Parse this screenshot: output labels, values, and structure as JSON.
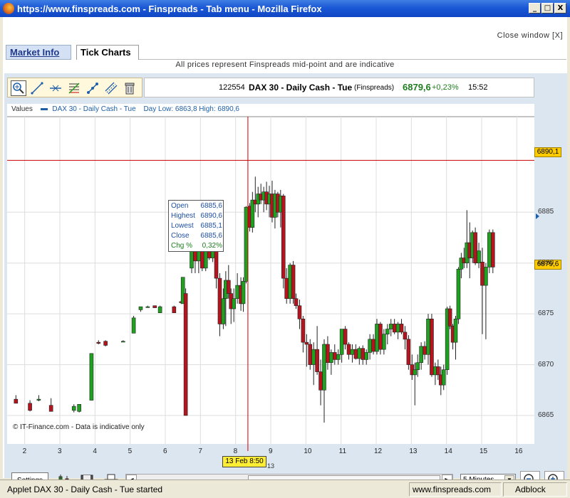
{
  "window": {
    "title": "https://www.finspreads.com - Finspreads - Tab menu - Mozilla Firefox",
    "min_label": "_",
    "max_label": "□",
    "close_label": "X"
  },
  "page": {
    "close_window": "Close window [X]",
    "tabs": [
      {
        "label": "Market Info"
      },
      {
        "label": "Tick Charts"
      }
    ],
    "notice": "All prices represent Finspreads mid-point and are indicative"
  },
  "toolbar": {
    "tools": [
      "zoom-select-icon",
      "trend-line-icon",
      "horizontal-line-icon",
      "fibonacci-icon",
      "line-tool-icon",
      "parallel-lines-icon",
      "trash-icon"
    ]
  },
  "info": {
    "id": "122554",
    "instrument": "DAX 30 - Daily Cash - Tue",
    "source": "(Finspreads)",
    "price": "6879,6",
    "change": "+0,23%",
    "time": "15:52"
  },
  "legend": {
    "values_label": "Values",
    "series": "DAX 30 - Daily Cash - Tue",
    "daylow": "Day Low: 6863,8 High: 6890,6"
  },
  "tooltip": {
    "rows": [
      {
        "k": "Open",
        "v": "6885,6"
      },
      {
        "k": "Highest",
        "v": "6890,6"
      },
      {
        "k": "Lowest",
        "v": "6885,1"
      },
      {
        "k": "Close",
        "v": "6885,6"
      },
      {
        "k": "Chg %",
        "v": "0,32%"
      }
    ]
  },
  "price_tags": {
    "high": "6890,1",
    "last": "6879,6"
  },
  "crosshair": {
    "time": "13 Feb 8:50",
    "sub": "13"
  },
  "copyright": "© IT-Finance.com - Data is indicative only",
  "controls": {
    "settings": "Settings",
    "interval": "5 Minutes",
    "dropdown_arrow": "▼",
    "scroll_left": "◀",
    "scroll_right": "▶"
  },
  "status": {
    "text": "Applet DAX 30 - Daily Cash - Tue started",
    "domain": "www.finspreads.com",
    "adblock": "Adblock"
  },
  "colors": {
    "up": "#1ea11e",
    "down": "#b3141e",
    "crosshair": "#c80000",
    "grid": "#dddddd"
  },
  "chart_data": {
    "type": "candlestick",
    "title": "DAX 30 - Daily Cash - Tue",
    "x_ticks": [
      "2",
      "3",
      "4",
      "5",
      "6",
      "7",
      "8",
      "9",
      "10",
      "11",
      "12",
      "13",
      "14",
      "15",
      "16"
    ],
    "x_tick_values": [
      2,
      3,
      4,
      5,
      6,
      7,
      8,
      9,
      10,
      11,
      12,
      13,
      14,
      15,
      16
    ],
    "xlim": [
      1.5,
      16.5
    ],
    "y_ticks": [
      "6865",
      "6870",
      "6875",
      "6880",
      "6885"
    ],
    "y_tick_values": [
      6865,
      6870,
      6875,
      6880,
      6885
    ],
    "ylim": [
      6862.2,
      6894.4
    ],
    "high_line": 6890.1,
    "crosshair_x": 8.35,
    "grid": true,
    "candles": [
      {
        "t": 1.75,
        "o": 6866.6,
        "h": 6867.0,
        "l": 6866.3,
        "c": 6866.2
      },
      {
        "t": 2.15,
        "o": 6866.2,
        "h": 6866.5,
        "l": 6865.4,
        "c": 6865.5
      },
      {
        "t": 2.4,
        "o": 6866.5,
        "h": 6867.0,
        "l": 6866.4,
        "c": 6866.6
      },
      {
        "t": 2.75,
        "o": 6866.0,
        "h": 6866.7,
        "l": 6865.4,
        "c": 6865.4
      },
      {
        "t": 3.4,
        "o": 6865.5,
        "h": 6866.1,
        "l": 6865.3,
        "c": 6865.9
      },
      {
        "t": 3.55,
        "o": 6865.4,
        "h": 6866.0,
        "l": 6865.3,
        "c": 6866.1
      },
      {
        "t": 3.9,
        "o": 6866.5,
        "h": 6871.1,
        "l": 6866.5,
        "c": 6871.1
      },
      {
        "t": 4.1,
        "o": 6872.2,
        "h": 6872.4,
        "l": 6872.0,
        "c": 6872.1
      },
      {
        "t": 4.3,
        "o": 6872.3,
        "h": 6872.4,
        "l": 6871.8,
        "c": 6871.9
      },
      {
        "t": 4.8,
        "o": 6872.3,
        "h": 6872.4,
        "l": 6872.3,
        "c": 6872.3
      },
      {
        "t": 5.1,
        "o": 6873.1,
        "h": 6874.8,
        "l": 6873.1,
        "c": 6874.6
      },
      {
        "t": 5.3,
        "o": 6875.4,
        "h": 6875.7,
        "l": 6875.2,
        "c": 6875.7
      },
      {
        "t": 5.5,
        "o": 6875.7,
        "h": 6875.8,
        "l": 6875.6,
        "c": 6875.7
      },
      {
        "t": 5.7,
        "o": 6875.8,
        "h": 6875.8,
        "l": 6875.6,
        "c": 6875.6
      },
      {
        "t": 5.85,
        "o": 6875.1,
        "h": 6875.8,
        "l": 6875.1,
        "c": 6875.7
      },
      {
        "t": 6.25,
        "o": 6875.7,
        "h": 6875.8,
        "l": 6875.1,
        "c": 6875.1
      },
      {
        "t": 6.45,
        "o": 6876.2,
        "h": 6876.3,
        "l": 6876.0,
        "c": 6876.1
      },
      {
        "t": 6.5,
        "o": 6876.0,
        "h": 6878.6,
        "l": 6876.0,
        "c": 6878.6
      },
      {
        "t": 6.58,
        "o": 6877.0,
        "h": 6877.5,
        "l": 6865.0,
        "c": 6865.0
      },
      {
        "t": 6.75,
        "o": 6879.5,
        "h": 6882.0,
        "l": 6879.0,
        "c": 6881.5
      },
      {
        "t": 6.85,
        "o": 6881.5,
        "h": 6882.0,
        "l": 6879.0,
        "c": 6880.2
      },
      {
        "t": 6.95,
        "o": 6880.2,
        "h": 6884.2,
        "l": 6879.0,
        "c": 6884.0
      },
      {
        "t": 7.05,
        "o": 6884.0,
        "h": 6884.3,
        "l": 6879.2,
        "c": 6879.5
      },
      {
        "t": 7.15,
        "o": 6879.5,
        "h": 6881.7,
        "l": 6879.2,
        "c": 6881.4
      },
      {
        "t": 7.25,
        "o": 6881.4,
        "h": 6883.0,
        "l": 6880.3,
        "c": 6880.5
      },
      {
        "t": 7.35,
        "o": 6880.5,
        "h": 6884.5,
        "l": 6880.1,
        "c": 6882.1
      },
      {
        "t": 7.45,
        "o": 6882.1,
        "h": 6883.5,
        "l": 6877.5,
        "c": 6878.5
      },
      {
        "t": 7.55,
        "o": 6878.5,
        "h": 6879.0,
        "l": 6872.8,
        "c": 6874.0
      },
      {
        "t": 7.65,
        "o": 6874.0,
        "h": 6877.5,
        "l": 6873.5,
        "c": 6876.5
      },
      {
        "t": 7.72,
        "o": 6876.5,
        "h": 6879.2,
        "l": 6873.8,
        "c": 6878.3
      },
      {
        "t": 7.8,
        "o": 6878.3,
        "h": 6879.8,
        "l": 6876.5,
        "c": 6877.0
      },
      {
        "t": 7.87,
        "o": 6877.0,
        "h": 6877.5,
        "l": 6874.0,
        "c": 6875.5
      },
      {
        "t": 7.95,
        "o": 6875.5,
        "h": 6877.5,
        "l": 6874.2,
        "c": 6876.5
      },
      {
        "t": 8.05,
        "o": 6876.5,
        "h": 6879.0,
        "l": 6876.0,
        "c": 6877.8
      },
      {
        "t": 8.15,
        "o": 6877.8,
        "h": 6878.6,
        "l": 6875.3,
        "c": 6876.0
      },
      {
        "t": 8.22,
        "o": 6876.0,
        "h": 6878.6,
        "l": 6875.2,
        "c": 6878.2
      },
      {
        "t": 8.3,
        "o": 6878.2,
        "h": 6885.6,
        "l": 6878.0,
        "c": 6885.5
      },
      {
        "t": 8.4,
        "o": 6885.6,
        "h": 6885.9,
        "l": 6883.1,
        "c": 6883.5
      },
      {
        "t": 8.48,
        "o": 6883.5,
        "h": 6887.0,
        "l": 6883.0,
        "c": 6886.2
      },
      {
        "t": 8.56,
        "o": 6886.2,
        "h": 6888.5,
        "l": 6885.0,
        "c": 6885.8
      },
      {
        "t": 8.64,
        "o": 6885.8,
        "h": 6887.5,
        "l": 6884.5,
        "c": 6886.8
      },
      {
        "t": 8.72,
        "o": 6886.8,
        "h": 6887.8,
        "l": 6885.8,
        "c": 6886.2
      },
      {
        "t": 8.8,
        "o": 6886.2,
        "h": 6887.5,
        "l": 6885.0,
        "c": 6887.0
      },
      {
        "t": 8.88,
        "o": 6887.0,
        "h": 6888.0,
        "l": 6885.2,
        "c": 6885.8
      },
      {
        "t": 8.96,
        "o": 6885.8,
        "h": 6887.6,
        "l": 6884.5,
        "c": 6886.8
      },
      {
        "t": 9.04,
        "o": 6886.8,
        "h": 6888.1,
        "l": 6884.0,
        "c": 6884.5
      },
      {
        "t": 9.12,
        "o": 6884.5,
        "h": 6887.2,
        "l": 6883.4,
        "c": 6886.8
      },
      {
        "t": 9.2,
        "o": 6886.8,
        "h": 6887.0,
        "l": 6884.5,
        "c": 6885.0
      },
      {
        "t": 9.28,
        "o": 6885.0,
        "h": 6887.2,
        "l": 6883.5,
        "c": 6886.6
      },
      {
        "t": 9.36,
        "o": 6886.6,
        "h": 6886.8,
        "l": 6877.5,
        "c": 6878.5
      },
      {
        "t": 9.45,
        "o": 6878.5,
        "h": 6879.5,
        "l": 6876.0,
        "c": 6876.5
      },
      {
        "t": 9.55,
        "o": 6876.5,
        "h": 6880.0,
        "l": 6876.0,
        "c": 6879.8
      },
      {
        "t": 9.64,
        "o": 6879.8,
        "h": 6880.2,
        "l": 6876.0,
        "c": 6876.5
      },
      {
        "t": 9.72,
        "o": 6876.5,
        "h": 6877.0,
        "l": 6875.5,
        "c": 6875.8
      },
      {
        "t": 9.82,
        "o": 6875.8,
        "h": 6876.4,
        "l": 6873.5,
        "c": 6874.5
      },
      {
        "t": 9.92,
        "o": 6874.5,
        "h": 6874.8,
        "l": 6871.2,
        "c": 6872.2
      },
      {
        "t": 10.02,
        "o": 6872.2,
        "h": 6873.0,
        "l": 6869.8,
        "c": 6872.0
      },
      {
        "t": 10.12,
        "o": 6872.0,
        "h": 6872.5,
        "l": 6869.5,
        "c": 6870.0
      },
      {
        "t": 10.22,
        "o": 6870.0,
        "h": 6872.2,
        "l": 6868.0,
        "c": 6871.5
      },
      {
        "t": 10.32,
        "o": 6871.5,
        "h": 6873.8,
        "l": 6869.0,
        "c": 6869.3
      },
      {
        "t": 10.42,
        "o": 6869.3,
        "h": 6870.5,
        "l": 6866.0,
        "c": 6867.5
      },
      {
        "t": 10.52,
        "o": 6867.5,
        "h": 6872.5,
        "l": 6864.3,
        "c": 6872.0
      },
      {
        "t": 10.62,
        "o": 6872.0,
        "h": 6872.8,
        "l": 6869.5,
        "c": 6870.2
      },
      {
        "t": 10.72,
        "o": 6870.2,
        "h": 6871.5,
        "l": 6869.0,
        "c": 6871.2
      },
      {
        "t": 10.82,
        "o": 6871.2,
        "h": 6872.0,
        "l": 6870.0,
        "c": 6870.5
      },
      {
        "t": 10.92,
        "o": 6870.5,
        "h": 6871.5,
        "l": 6870.0,
        "c": 6871.0
      },
      {
        "t": 11.02,
        "o": 6871.0,
        "h": 6873.5,
        "l": 6870.2,
        "c": 6873.5
      },
      {
        "t": 11.12,
        "o": 6873.5,
        "h": 6873.8,
        "l": 6871.5,
        "c": 6872.0
      },
      {
        "t": 11.22,
        "o": 6872.0,
        "h": 6872.2,
        "l": 6870.5,
        "c": 6871.0
      },
      {
        "t": 11.32,
        "o": 6871.0,
        "h": 6872.0,
        "l": 6870.2,
        "c": 6871.5
      },
      {
        "t": 11.42,
        "o": 6871.5,
        "h": 6872.0,
        "l": 6870.5,
        "c": 6870.6
      },
      {
        "t": 11.52,
        "o": 6870.6,
        "h": 6871.8,
        "l": 6870.0,
        "c": 6871.6
      },
      {
        "t": 11.62,
        "o": 6871.6,
        "h": 6871.9,
        "l": 6870.0,
        "c": 6870.5
      },
      {
        "t": 11.72,
        "o": 6870.5,
        "h": 6871.5,
        "l": 6870.0,
        "c": 6871.2
      },
      {
        "t": 11.82,
        "o": 6871.2,
        "h": 6873.0,
        "l": 6870.5,
        "c": 6872.5
      },
      {
        "t": 11.92,
        "o": 6872.5,
        "h": 6873.0,
        "l": 6871.0,
        "c": 6871.3
      },
      {
        "t": 12.02,
        "o": 6871.3,
        "h": 6874.5,
        "l": 6871.0,
        "c": 6874.0
      },
      {
        "t": 12.12,
        "o": 6874.0,
        "h": 6874.2,
        "l": 6871.0,
        "c": 6871.5
      },
      {
        "t": 12.22,
        "o": 6871.5,
        "h": 6873.5,
        "l": 6871.0,
        "c": 6873.0
      },
      {
        "t": 12.32,
        "o": 6873.0,
        "h": 6874.0,
        "l": 6872.0,
        "c": 6873.5
      },
      {
        "t": 12.42,
        "o": 6873.5,
        "h": 6874.5,
        "l": 6872.8,
        "c": 6874.0
      },
      {
        "t": 12.52,
        "o": 6874.0,
        "h": 6874.5,
        "l": 6873.0,
        "c": 6873.2
      },
      {
        "t": 12.62,
        "o": 6873.2,
        "h": 6874.2,
        "l": 6872.5,
        "c": 6874.0
      },
      {
        "t": 12.72,
        "o": 6874.0,
        "h": 6874.5,
        "l": 6873.0,
        "c": 6873.2
      },
      {
        "t": 12.82,
        "o": 6873.2,
        "h": 6873.8,
        "l": 6871.5,
        "c": 6872.5
      },
      {
        "t": 12.92,
        "o": 6872.5,
        "h": 6872.9,
        "l": 6869.5,
        "c": 6870.0
      },
      {
        "t": 13.02,
        "o": 6870.0,
        "h": 6871.0,
        "l": 6868.5,
        "c": 6869.0
      },
      {
        "t": 13.1,
        "o": 6869.0,
        "h": 6870.2,
        "l": 6866.0,
        "c": 6869.5
      },
      {
        "t": 13.18,
        "o": 6869.5,
        "h": 6871.0,
        "l": 6868.8,
        "c": 6870.2
      },
      {
        "t": 13.28,
        "o": 6870.2,
        "h": 6872.2,
        "l": 6869.5,
        "c": 6871.8
      },
      {
        "t": 13.38,
        "o": 6871.8,
        "h": 6872.3,
        "l": 6870.5,
        "c": 6871.0
      },
      {
        "t": 13.48,
        "o": 6871.0,
        "h": 6875.0,
        "l": 6870.0,
        "c": 6874.5
      },
      {
        "t": 13.58,
        "o": 6874.5,
        "h": 6875.0,
        "l": 6868.8,
        "c": 6869.0
      },
      {
        "t": 13.68,
        "o": 6869.0,
        "h": 6870.2,
        "l": 6868.0,
        "c": 6869.8
      },
      {
        "t": 13.76,
        "o": 6869.8,
        "h": 6870.5,
        "l": 6868.5,
        "c": 6869.0
      },
      {
        "t": 13.84,
        "o": 6869.0,
        "h": 6869.8,
        "l": 6867.0,
        "c": 6868.0
      },
      {
        "t": 13.92,
        "o": 6868.0,
        "h": 6870.0,
        "l": 6867.5,
        "c": 6869.5
      },
      {
        "t": 14.02,
        "o": 6869.5,
        "h": 6875.7,
        "l": 6869.0,
        "c": 6875.5
      },
      {
        "t": 14.1,
        "o": 6875.5,
        "h": 6875.8,
        "l": 6873.5,
        "c": 6873.8
      },
      {
        "t": 14.18,
        "o": 6873.8,
        "h": 6874.0,
        "l": 6871.5,
        "c": 6872.2
      },
      {
        "t": 14.26,
        "o": 6872.2,
        "h": 6874.8,
        "l": 6870.5,
        "c": 6874.5
      },
      {
        "t": 14.34,
        "o": 6874.5,
        "h": 6879.6,
        "l": 6874.0,
        "c": 6879.4
      },
      {
        "t": 14.42,
        "o": 6879.4,
        "h": 6881.0,
        "l": 6878.5,
        "c": 6880.5
      },
      {
        "t": 14.5,
        "o": 6880.5,
        "h": 6881.5,
        "l": 6879.5,
        "c": 6880.0
      },
      {
        "t": 14.58,
        "o": 6880.0,
        "h": 6885.2,
        "l": 6879.5,
        "c": 6882.0
      },
      {
        "t": 14.66,
        "o": 6882.0,
        "h": 6884.0,
        "l": 6878.5,
        "c": 6880.5
      },
      {
        "t": 14.74,
        "o": 6880.5,
        "h": 6883.2,
        "l": 6880.0,
        "c": 6883.0
      },
      {
        "t": 14.82,
        "o": 6883.0,
        "h": 6883.5,
        "l": 6879.8,
        "c": 6880.0
      },
      {
        "t": 14.92,
        "o": 6880.0,
        "h": 6882.0,
        "l": 6879.5,
        "c": 6881.2
      },
      {
        "t": 15.02,
        "o": 6880.1,
        "h": 6881.5,
        "l": 6873.0,
        "c": 6877.8
      },
      {
        "t": 15.12,
        "o": 6877.8,
        "h": 6880.0,
        "l": 6872.5,
        "c": 6879.6
      },
      {
        "t": 15.22,
        "o": 6879.6,
        "h": 6883.3,
        "l": 6879.0,
        "c": 6883.0
      },
      {
        "t": 15.32,
        "o": 6883.0,
        "h": 6883.3,
        "l": 6879.0,
        "c": 6879.6
      }
    ]
  }
}
